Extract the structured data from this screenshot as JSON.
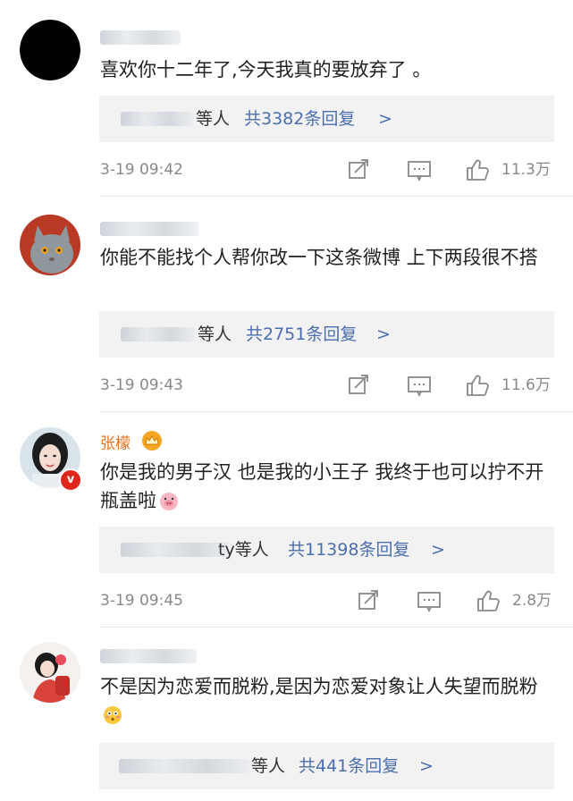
{
  "comments": [
    {
      "username": "",
      "text": "喜欢你十二年了,今天我真的要放弃了 。",
      "reply_who_suffix": "等人",
      "reply_count": "共3382条回复",
      "chevron": ">",
      "time": "3-19 09:42",
      "likes": "11.3万",
      "avatar": "black-circle"
    },
    {
      "username": "",
      "text": "你能不能找个人帮你改一下这条微博 上下两段很不搭",
      "reply_who_suffix": "等人",
      "reply_count": "共2751条回复",
      "chevron": ">",
      "time": "3-19 09:43",
      "likes": "11.6万",
      "avatar": "cat-photo"
    },
    {
      "username": "张檬",
      "text": "你是我的男子汉 也是我的小王子 我终于也可以拧不开瓶盖啦",
      "reply_who_suffix": "ty等人",
      "reply_count": "共11398条回复",
      "chevron": ">",
      "time": "3-19 09:45",
      "likes": "2.8万",
      "avatar": "woman-portrait",
      "badges": [
        "crown-icon",
        "verified-v-icon"
      ]
    },
    {
      "username": "",
      "text": "不是因为恋爱而脱粉,是因为恋爱对象让人失望而脱粉",
      "reply_who_suffix": "等人",
      "reply_count": "共441条回复",
      "chevron": ">",
      "avatar": "illustrated-girl"
    }
  ],
  "colors": {
    "link_blue": "#4b6eaf",
    "meta_gray": "#888888",
    "reply_bg": "#f2f2f2",
    "vip_orange": "#e8701a"
  }
}
